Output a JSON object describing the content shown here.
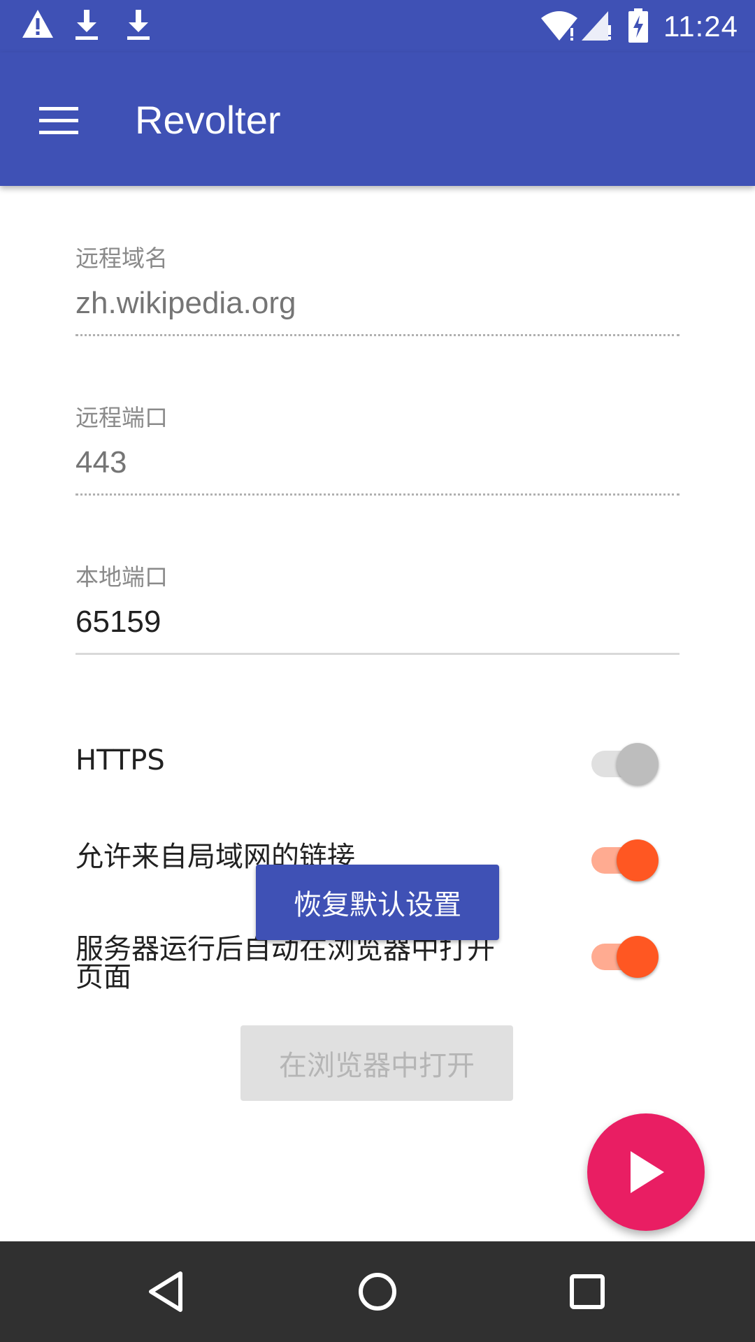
{
  "status_bar": {
    "time": "11:24",
    "left_icons": [
      "warning-icon",
      "download-icon",
      "download-icon"
    ],
    "right_icons": [
      "wifi-icon",
      "signal-icon",
      "battery-charging-icon"
    ]
  },
  "app_bar": {
    "title": "Revolter",
    "menu_icon": "hamburger-menu-icon"
  },
  "form": {
    "remote_domain": {
      "label": "远程域名",
      "placeholder": "zh.wikipedia.org",
      "value": ""
    },
    "remote_port": {
      "label": "远程端口",
      "placeholder": "443",
      "value": ""
    },
    "local_port": {
      "label": "本地端口",
      "value": "65159"
    }
  },
  "switches": {
    "https": {
      "label": "HTTPS",
      "checked": false
    },
    "allow_lan": {
      "label": "允许来自局域网的链接",
      "checked": true
    },
    "auto_open": {
      "label_line1": "服务器运行后自动在浏览器中打开",
      "label_line2": "页面",
      "checked": true
    }
  },
  "buttons": {
    "restore_defaults": "恢复默认设置",
    "open_in_browser": "在浏览器中打开"
  },
  "colors": {
    "primary": "#3f51b5",
    "accent_switch": "#ff5722",
    "fab": "#e91e63",
    "nav_bar": "#303030"
  },
  "nav_bar": {
    "icons": [
      "back-icon",
      "home-icon",
      "recents-icon"
    ]
  }
}
